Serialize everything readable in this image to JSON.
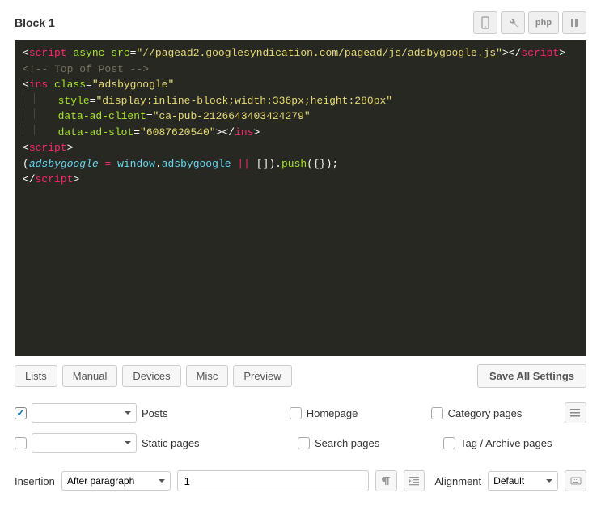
{
  "header": {
    "title": "Block 1",
    "php_label": "php"
  },
  "code": {
    "lines": [
      {
        "indent": 0,
        "segments": [
          {
            "t": "bracket",
            "v": "<"
          },
          {
            "t": "tag",
            "v": "script"
          },
          {
            "t": "plain",
            "v": " "
          },
          {
            "t": "attr",
            "v": "async"
          },
          {
            "t": "plain",
            "v": " "
          },
          {
            "t": "attr",
            "v": "src"
          },
          {
            "t": "op",
            "v": "="
          },
          {
            "t": "str",
            "v": "\"//pagead2.googlesyndication.com/pagead/js/adsbygoogle.js\""
          },
          {
            "t": "bracket",
            "v": ">"
          },
          {
            "t": "bracket",
            "v": "</"
          },
          {
            "t": "tag",
            "v": "script"
          },
          {
            "t": "bracket",
            "v": ">"
          }
        ]
      },
      {
        "indent": 0,
        "segments": [
          {
            "t": "comment",
            "v": "<!-- Top of Post -->"
          }
        ]
      },
      {
        "indent": 0,
        "segments": [
          {
            "t": "bracket",
            "v": "<"
          },
          {
            "t": "tag",
            "v": "ins"
          },
          {
            "t": "plain",
            "v": " "
          },
          {
            "t": "attr",
            "v": "class"
          },
          {
            "t": "op",
            "v": "="
          },
          {
            "t": "str",
            "v": "\"adsbygoogle\""
          }
        ]
      },
      {
        "indent": 2,
        "segments": [
          {
            "t": "attr",
            "v": "style"
          },
          {
            "t": "op",
            "v": "="
          },
          {
            "t": "str",
            "v": "\"display:inline-block;width:336px;height:280px\""
          }
        ]
      },
      {
        "indent": 2,
        "segments": [
          {
            "t": "attr",
            "v": "data-ad-client"
          },
          {
            "t": "op",
            "v": "="
          },
          {
            "t": "str",
            "v": "\"ca-pub-2126643403424279\""
          }
        ]
      },
      {
        "indent": 2,
        "segments": [
          {
            "t": "attr",
            "v": "data-ad-slot"
          },
          {
            "t": "op",
            "v": "="
          },
          {
            "t": "str",
            "v": "\"6087620540\""
          },
          {
            "t": "bracket",
            "v": ">"
          },
          {
            "t": "bracket",
            "v": "</"
          },
          {
            "t": "tag",
            "v": "ins"
          },
          {
            "t": "bracket",
            "v": ">"
          }
        ]
      },
      {
        "indent": 0,
        "segments": [
          {
            "t": "bracket",
            "v": "<"
          },
          {
            "t": "tag",
            "v": "script"
          },
          {
            "t": "bracket",
            "v": ">"
          }
        ]
      },
      {
        "indent": 0,
        "segments": [
          {
            "t": "plain",
            "v": "("
          },
          {
            "t": "name",
            "v": "adsbygoogle"
          },
          {
            "t": "plain",
            "v": " "
          },
          {
            "t": "err",
            "v": "="
          },
          {
            "t": "plain",
            "v": " "
          },
          {
            "t": "func",
            "v": "window"
          },
          {
            "t": "dot",
            "v": "."
          },
          {
            "t": "func",
            "v": "adsbygoogle"
          },
          {
            "t": "plain",
            "v": " "
          },
          {
            "t": "err",
            "v": "||"
          },
          {
            "t": "plain",
            "v": " []"
          },
          {
            "t": "plain",
            "v": ")"
          },
          {
            "t": "dot",
            "v": "."
          },
          {
            "t": "call",
            "v": "push"
          },
          {
            "t": "plain",
            "v": "({});"
          }
        ]
      },
      {
        "indent": 0,
        "segments": [
          {
            "t": "bracket",
            "v": "</"
          },
          {
            "t": "tag",
            "v": "script"
          },
          {
            "t": "bracket",
            "v": ">"
          }
        ]
      }
    ]
  },
  "buttons": {
    "lists": "Lists",
    "manual": "Manual",
    "devices": "Devices",
    "misc": "Misc",
    "preview": "Preview",
    "save": "Save All Settings"
  },
  "options": {
    "row1": {
      "cb1": true,
      "select1": "",
      "label1": "Posts",
      "cb2": false,
      "label2": "Homepage",
      "cb3": false,
      "label3": "Category pages"
    },
    "row2": {
      "cb1": false,
      "select1": "",
      "label1": "Static pages",
      "cb2": false,
      "label2": "Search pages",
      "cb3": false,
      "label3": "Tag / Archive pages"
    }
  },
  "insertion": {
    "label": "Insertion",
    "select": "After paragraph",
    "value": "1",
    "alignment_label": "Alignment",
    "alignment_select": "Default"
  }
}
